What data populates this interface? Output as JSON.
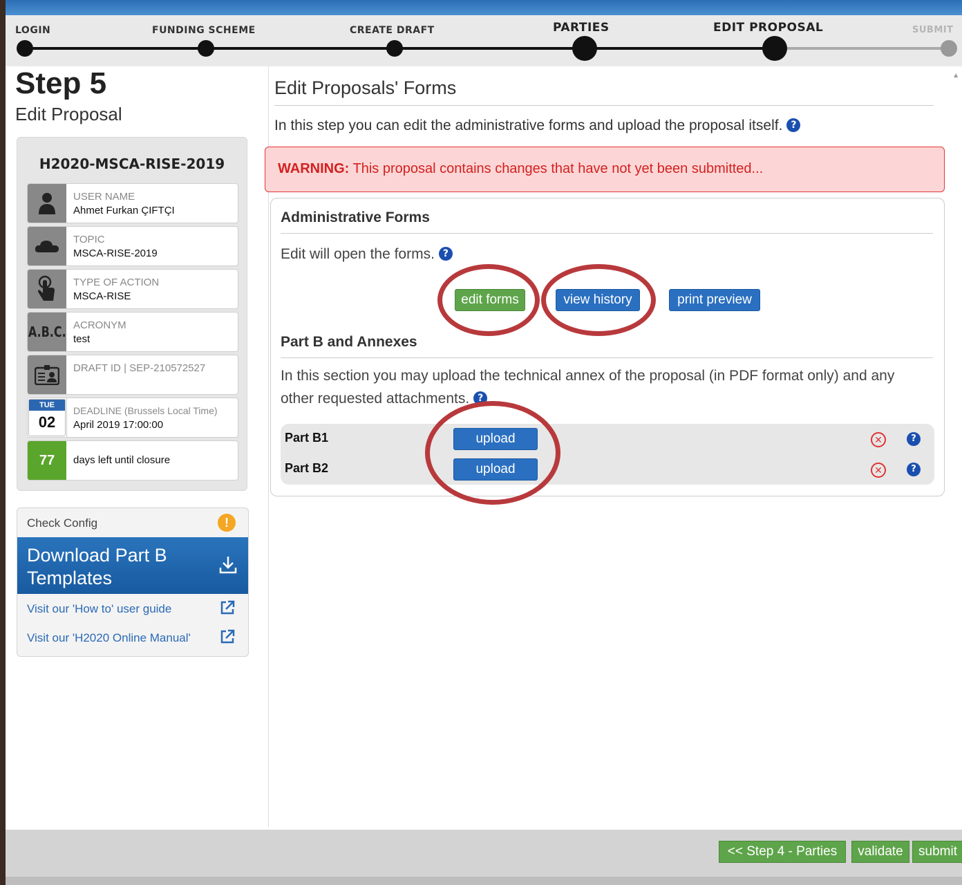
{
  "steps": [
    {
      "label": "LOGIN"
    },
    {
      "label": "FUNDING SCHEME"
    },
    {
      "label": "CREATE DRAFT"
    },
    {
      "label": "PARTIES"
    },
    {
      "label": "EDIT PROPOSAL"
    },
    {
      "label": "SUBMIT"
    }
  ],
  "left": {
    "step_title": "Step 5",
    "step_subtitle": "Edit Proposal",
    "call_id": "H2020-MSCA-RISE-2019",
    "user_name": {
      "label": "USER NAME",
      "value": "Ahmet Furkan ÇIFTÇI",
      "icon": "person-icon"
    },
    "topic": {
      "label": "TOPIC",
      "value": "MSCA-RISE-2019",
      "icon": "cloud-icon"
    },
    "type_of_action": {
      "label": "TYPE OF ACTION",
      "value": "MSCA-RISE",
      "icon": "hand-pointer-icon"
    },
    "acronym": {
      "label": "ACRONYM",
      "value": "test",
      "icon_text": "A.B.C."
    },
    "draft_id": {
      "label": "DRAFT ID",
      "separator": "|",
      "value": "SEP-210572527",
      "icon": "id-card-icon"
    },
    "deadline": {
      "label": "DEADLINE",
      "label_note": "(Brussels Local Time)",
      "value": "April 2019 17:00:00",
      "weekday": "TUE",
      "day": "02"
    },
    "days_left": {
      "count": "77",
      "text": "days left until closure",
      "color": "#5aa52b"
    }
  },
  "tools": {
    "check_config": "Check Config",
    "download_title": "Download Part B Templates",
    "links": [
      "Visit our 'How to' user guide",
      "Visit our 'H2020 Online Manual'"
    ]
  },
  "main": {
    "title": "Edit Proposals' Forms",
    "intro": "In this step you can edit the administrative forms and upload the proposal itself.",
    "warning_label": "WARNING:",
    "warning_text": " This proposal contains changes that have not yet been submitted...",
    "admin_title": "Administrative Forms",
    "admin_text": "Edit will open the forms.",
    "buttons": {
      "edit_forms": "edit forms",
      "view_history": "view history",
      "print_preview": "print preview"
    },
    "partb_title": "Part B and Annexes",
    "partb_text": "In this section you may upload the technical annex of the proposal (in PDF format only) and any other requested attachments.",
    "parts": [
      {
        "label": "Part B1",
        "button": "upload"
      },
      {
        "label": "Part B2",
        "button": "upload"
      }
    ]
  },
  "footer": {
    "prev": "<< Step 4 - Parties",
    "validate": "validate",
    "submit": "submit"
  },
  "colors": {
    "accent_blue": "#2a6fc0",
    "accent_green": "#5ea44a",
    "warning_red": "#d42020",
    "highlight_ring": "#b8393c"
  }
}
